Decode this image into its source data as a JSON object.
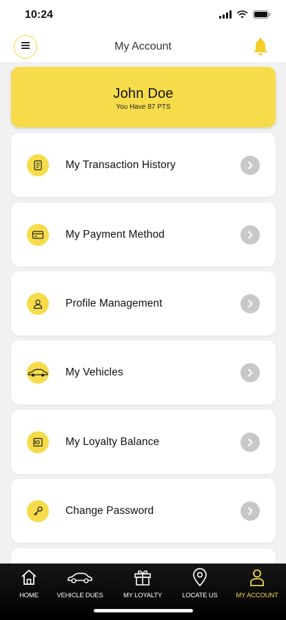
{
  "status_bar": {
    "time": "10:24"
  },
  "header": {
    "title": "My Account"
  },
  "profile": {
    "name": "John Doe",
    "points_text": "You Have 87 PTS"
  },
  "menu": {
    "items": [
      {
        "label": "My Transaction History",
        "icon": "receipt-icon"
      },
      {
        "label": "My Payment Method",
        "icon": "credit-card-icon"
      },
      {
        "label": "Profile Management",
        "icon": "user-icon"
      },
      {
        "label": "My Vehicles",
        "icon": "car-icon"
      },
      {
        "label": "My Loyalty Balance",
        "icon": "safe-icon"
      },
      {
        "label": "Change Password",
        "icon": "key-icon"
      }
    ]
  },
  "bottom_nav": {
    "items": [
      {
        "label": "HOME",
        "icon": "home-icon",
        "active": false
      },
      {
        "label": "VEHICLE DUES",
        "icon": "car-icon",
        "active": false
      },
      {
        "label": "MY LOYALTY",
        "icon": "gift-icon",
        "active": false
      },
      {
        "label": "LOCATE US",
        "icon": "location-pin-icon",
        "active": false
      },
      {
        "label": "MY ACCOUNT",
        "icon": "user-icon",
        "active": true
      }
    ]
  },
  "colors": {
    "accent": "#f6dc4b",
    "background": "#f1f1f1",
    "nav_background": "#000000",
    "arrow_circle": "#c8c8c8"
  }
}
